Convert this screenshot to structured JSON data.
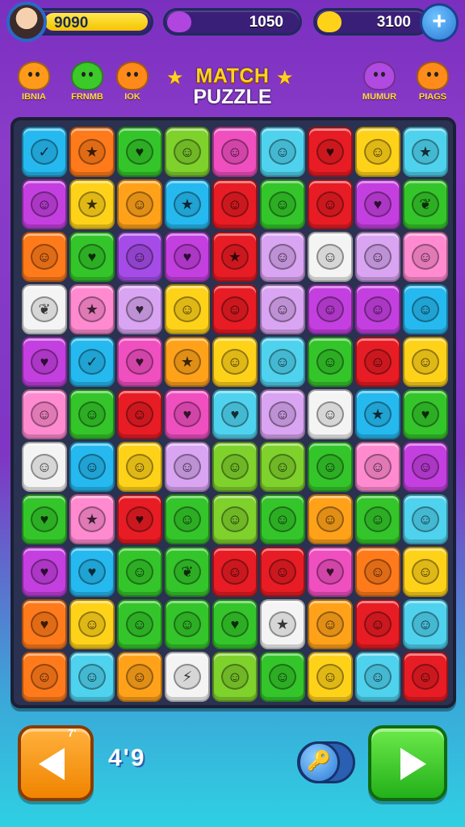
{
  "topbar": {
    "player_score": "9090",
    "gems": "1050",
    "coins": "3100",
    "plus_label": "+"
  },
  "header": {
    "title_line1": "MATCH",
    "title_line2": "PUZZLE",
    "left_items": [
      {
        "label": "IBNIA",
        "color": "#ff9a1a"
      },
      {
        "label": "FRNMB",
        "color": "#3cc92a"
      },
      {
        "label": "IOK",
        "color": "#ff8a1a"
      }
    ],
    "right_items": [
      {
        "label": "MUMUR",
        "color": "#b04ae0"
      },
      {
        "label": "PIAGS",
        "color": "#ff8c1a"
      }
    ]
  },
  "board": {
    "rows": [
      [
        [
          "c-blue",
          "✓"
        ],
        [
          "c-orange",
          "★"
        ],
        [
          "c-green",
          "♥"
        ],
        [
          "c-lime",
          "☺"
        ],
        [
          "c-pink",
          "☺"
        ],
        [
          "c-cyan",
          "☺"
        ],
        [
          "c-red",
          "♥"
        ],
        [
          "c-yellow",
          "☺"
        ],
        [
          "c-cyan",
          "★"
        ]
      ],
      [
        [
          "c-magenta",
          "☺"
        ],
        [
          "c-yellow",
          "★"
        ],
        [
          "c-amber",
          "☺"
        ],
        [
          "c-blue",
          "★"
        ],
        [
          "c-red",
          "☺"
        ],
        [
          "c-green",
          "☺"
        ],
        [
          "c-red",
          "☺"
        ],
        [
          "c-magenta",
          "♥"
        ],
        [
          "c-green",
          "❦"
        ]
      ],
      [
        [
          "c-orange",
          "☺"
        ],
        [
          "c-green",
          "♥"
        ],
        [
          "c-purple",
          "☺"
        ],
        [
          "c-magenta",
          "♥"
        ],
        [
          "c-red",
          "★"
        ],
        [
          "c-lavender",
          "☺"
        ],
        [
          "c-white",
          "☺"
        ],
        [
          "c-lavender",
          "☺"
        ],
        [
          "c-rose",
          "☺"
        ]
      ],
      [
        [
          "c-white",
          "❦"
        ],
        [
          "c-rose",
          "★"
        ],
        [
          "c-lavender",
          "♥"
        ],
        [
          "c-yellow",
          "☺"
        ],
        [
          "c-red",
          "☺"
        ],
        [
          "c-lavender",
          "☺"
        ],
        [
          "c-magenta",
          "☺"
        ],
        [
          "c-magenta",
          "☺"
        ],
        [
          "c-blue",
          "☺"
        ]
      ],
      [
        [
          "c-magenta",
          "♥"
        ],
        [
          "c-blue",
          "✓"
        ],
        [
          "c-pink",
          "♥"
        ],
        [
          "c-amber",
          "★"
        ],
        [
          "c-yellow",
          "☺"
        ],
        [
          "c-cyan",
          "☺"
        ],
        [
          "c-green",
          "☺"
        ],
        [
          "c-red",
          "☺"
        ],
        [
          "c-yellow",
          "☺"
        ]
      ],
      [
        [
          "c-rose",
          "☺"
        ],
        [
          "c-green",
          "☺"
        ],
        [
          "c-red",
          "☺"
        ],
        [
          "c-pink",
          "♥"
        ],
        [
          "c-cyan",
          "♥"
        ],
        [
          "c-lavender",
          "☺"
        ],
        [
          "c-white",
          "☺"
        ],
        [
          "c-blue",
          "★"
        ],
        [
          "c-green",
          "♥"
        ]
      ],
      [
        [
          "c-white",
          "☺"
        ],
        [
          "c-blue",
          "☺"
        ],
        [
          "c-yellow",
          "☺"
        ],
        [
          "c-lavender",
          "☺"
        ],
        [
          "c-lime",
          "☺"
        ],
        [
          "c-lime",
          "☺"
        ],
        [
          "c-green",
          "☺"
        ],
        [
          "c-rose",
          "☺"
        ],
        [
          "c-magenta",
          "☺"
        ]
      ],
      [
        [
          "c-green",
          "♥"
        ],
        [
          "c-rose",
          "★"
        ],
        [
          "c-red",
          "♥"
        ],
        [
          "c-green",
          "☺"
        ],
        [
          "c-lime",
          "☺"
        ],
        [
          "c-green",
          "☺"
        ],
        [
          "c-amber",
          "☺"
        ],
        [
          "c-green",
          "☺"
        ],
        [
          "c-cyan",
          "☺"
        ]
      ],
      [
        [
          "c-magenta",
          "♥"
        ],
        [
          "c-blue",
          "♥"
        ],
        [
          "c-green",
          "☺"
        ],
        [
          "c-green",
          "❦"
        ],
        [
          "c-red",
          "☺"
        ],
        [
          "c-red",
          "☺"
        ],
        [
          "c-pink",
          "♥"
        ],
        [
          "c-orange",
          "☺"
        ],
        [
          "c-yellow",
          "☺"
        ]
      ],
      [
        [
          "c-orange",
          "♥"
        ],
        [
          "c-yellow",
          "☺"
        ],
        [
          "c-green",
          "☺"
        ],
        [
          "c-green",
          "☺"
        ],
        [
          "c-green",
          "♥"
        ],
        [
          "c-white",
          "★"
        ],
        [
          "c-amber",
          "☺"
        ],
        [
          "c-red",
          "☺"
        ],
        [
          "c-cyan",
          "☺"
        ]
      ],
      [
        [
          "c-orange",
          "☺"
        ],
        [
          "c-cyan",
          "☺"
        ],
        [
          "c-amber",
          "☺"
        ],
        [
          "c-white",
          "⚡"
        ],
        [
          "c-lime",
          "☺"
        ],
        [
          "c-green",
          "☺"
        ],
        [
          "c-yellow",
          "☺"
        ],
        [
          "c-cyan",
          "☺"
        ],
        [
          "c-red",
          "☺"
        ]
      ]
    ]
  },
  "bottom": {
    "back_badge": "7'",
    "middle_text": "4'9",
    "toggle_icon": "🔑"
  }
}
